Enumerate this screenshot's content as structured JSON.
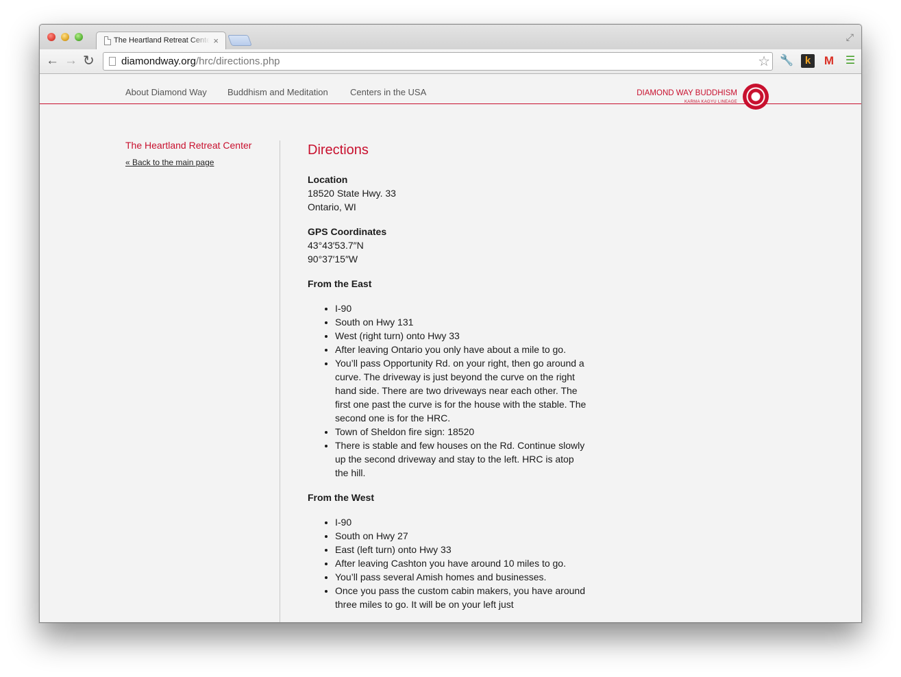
{
  "browser": {
    "tab_title": "The Heartland Retreat Center",
    "tab_close": "×",
    "url_domain": "diamondway.org",
    "url_path": "/hrc/directions.php",
    "icons": [
      "back-arrow-icon",
      "forward-arrow-icon",
      "reload-icon",
      "star-icon",
      "wrench-icon",
      "k-icon",
      "gmail-icon",
      "menu-icon"
    ]
  },
  "site": {
    "nav": [
      "About Diamond Way",
      "Buddhism and Meditation",
      "Centers in the USA"
    ],
    "logo_title": "DIAMOND WAY BUDDHISM",
    "logo_sub": "KARMA KAGYU LINEAGE",
    "accent_color": "#c8102e"
  },
  "sidebar": {
    "title": "The Heartland Retreat Center",
    "back_link": "« Back to the main page"
  },
  "content": {
    "heading": "Directions",
    "location": {
      "label": "Location",
      "line1": "18520 State Hwy. 33",
      "line2": "Ontario, WI"
    },
    "gps": {
      "label": "GPS Coordinates",
      "lat": "43°43′53.7″N",
      "lon": "90°37′15″W"
    },
    "east": {
      "label": "From the East",
      "steps": [
        "I-90",
        "South on Hwy 131",
        "West (right turn) onto Hwy 33",
        "After leaving Ontario you only have about a mile to go.",
        "You’ll pass Opportunity Rd. on your right, then go around a curve. The driveway is just beyond the curve on the right hand side. There are two driveways near each other. The first one past the curve is for the house with the stable. The second one is for the HRC.",
        "Town of Sheldon fire sign: 18520",
        "There is stable and few houses on the Rd. Continue slowly up the second driveway and stay to the left. HRC is atop the hill."
      ]
    },
    "west": {
      "label": "From the West",
      "steps": [
        "I-90",
        "South on Hwy 27",
        "East (left turn) onto Hwy 33",
        "After leaving Cashton you have around 10 miles to go.",
        "You’ll pass several Amish homes and businesses.",
        "Once you pass the custom cabin makers, you have around three miles to go. It will be on your left just"
      ]
    }
  }
}
